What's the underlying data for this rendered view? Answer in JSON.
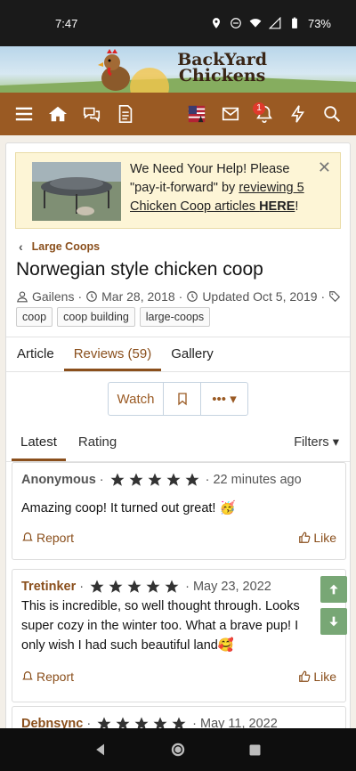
{
  "status": {
    "time": "7:47",
    "battery": "73%"
  },
  "site": {
    "logo_line1": "BackYard",
    "logo_line2": "Chickens"
  },
  "nav": {
    "alerts_badge": "1"
  },
  "notice": {
    "text_before": "We Need Your Help! Please \"pay-it-forward\" by ",
    "link_text": "reviewing 5 Chicken Coop articles ",
    "link_bold": "HERE",
    "text_after": "!"
  },
  "breadcrumb": {
    "label": "Large Coops"
  },
  "article": {
    "title": "Norwegian style chicken coop",
    "author": "Gailens",
    "date": "Mar 28, 2018",
    "updated": "Updated Oct 5, 2019",
    "tags": [
      "coop",
      "coop building",
      "large-coops"
    ]
  },
  "tabs": [
    "Article",
    "Reviews (59)",
    "Gallery"
  ],
  "actions": {
    "watch": "Watch"
  },
  "subtabs": {
    "latest": "Latest",
    "rating": "Rating",
    "filters": "Filters"
  },
  "reviews": [
    {
      "author": "Anonymous",
      "stars": 5,
      "time": "22 minutes ago",
      "body": "Amazing coop! It turned out great! 🥳",
      "report": "Report",
      "like": "Like"
    },
    {
      "author": "Tretinker",
      "stars": 5,
      "time": "May 23, 2022",
      "body": "This is incredible, so well thought through. Looks super cozy in the winter too. What a brave pup! I only wish I had such beautiful land🥰",
      "report": "Report",
      "like": "Like"
    },
    {
      "author": "Debnsync",
      "stars": 5,
      "time": "May 11, 2022"
    }
  ],
  "colors": {
    "brown": "#9a5a23",
    "accent": "#8a4f1c",
    "notice_bg": "#fdf5d6",
    "scroll_btn": "#6da06a"
  }
}
